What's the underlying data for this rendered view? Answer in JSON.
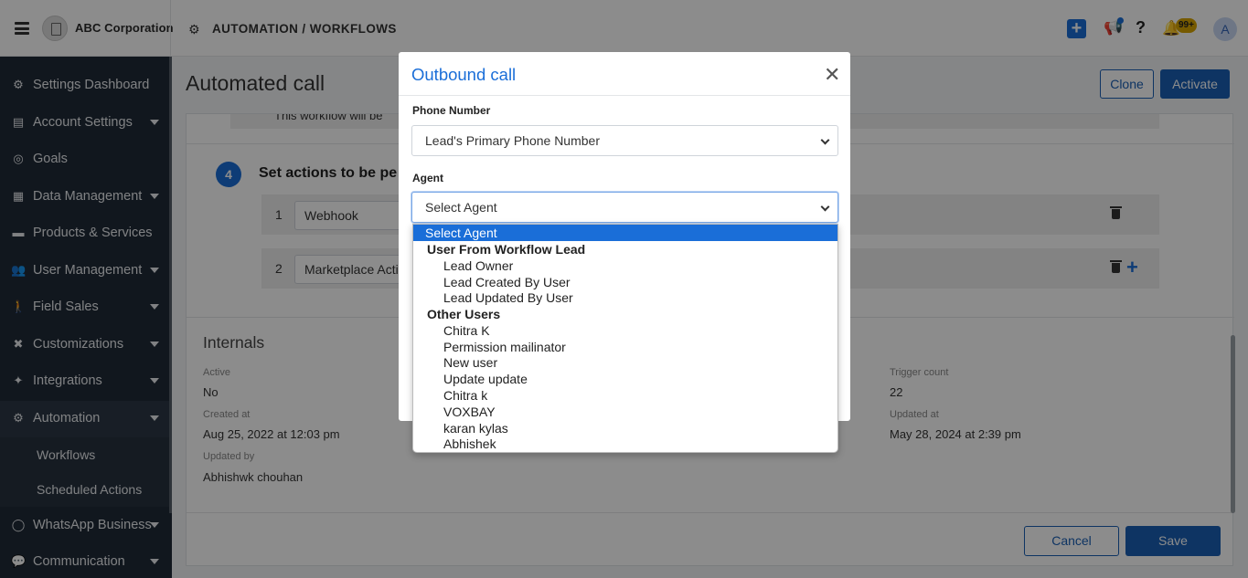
{
  "header": {
    "brand": "ABC Corporation",
    "breadcrumb": "AUTOMATION / WORKFLOWS",
    "notification_badge": "99+",
    "avatar_initial": "A"
  },
  "sidebar": {
    "items": [
      {
        "label": "Settings Dashboard",
        "icon": "gear-icon",
        "caret": false
      },
      {
        "label": "Account Settings",
        "icon": "id-card-icon",
        "caret": true
      },
      {
        "label": "Goals",
        "icon": "target-icon",
        "caret": false
      },
      {
        "label": "Data Management",
        "icon": "table-icon",
        "caret": true
      },
      {
        "label": "Products & Services",
        "icon": "box-icon",
        "caret": false
      },
      {
        "label": "User Management",
        "icon": "users-icon",
        "caret": true
      },
      {
        "label": "Field Sales",
        "icon": "person-walk-icon",
        "caret": true
      },
      {
        "label": "Customizations",
        "icon": "tools-icon",
        "caret": true
      },
      {
        "label": "Integrations",
        "icon": "magic-wand-icon",
        "caret": true
      },
      {
        "label": "Automation",
        "icon": "cogs-icon",
        "caret": true
      }
    ],
    "sub_items": [
      "Workflows",
      "Scheduled Actions"
    ],
    "items_after": [
      {
        "label": "WhatsApp Business",
        "icon": "whatsapp-icon",
        "caret": true
      },
      {
        "label": "Communication",
        "icon": "chat-icon",
        "caret": true
      }
    ]
  },
  "main": {
    "title": "Automated call",
    "clone_label": "Clone",
    "activate_label": "Activate",
    "description_fragment": "This workflow will be",
    "step_number": "4",
    "step_title": "Set actions to be pe",
    "actions": [
      {
        "num": "1",
        "value": "Webhook"
      },
      {
        "num": "2",
        "value": "Marketplace Acti"
      }
    ],
    "internals_title": "Internals",
    "active_label": "Active",
    "active_value": "No",
    "created_label": "Created at",
    "created_value": "Aug 25, 2022 at 12:03 pm",
    "updated_by_label": "Updated by",
    "updated_by_value": "Abhishwk chouhan",
    "trigger_label": "Trigger count",
    "trigger_value": "22",
    "updated_at_label": "Updated at",
    "updated_at_value": "May 28, 2024 at 2:39 pm",
    "cancel_label": "Cancel",
    "save_label": "Save"
  },
  "modal": {
    "title": "Outbound call",
    "phone_label": "Phone Number",
    "phone_value": "Lead's Primary Phone Number",
    "agent_label": "Agent",
    "agent_value": "Select Agent",
    "options": {
      "selected": "Select Agent",
      "group1": "User From Workflow Lead",
      "group1_items": [
        "Lead Owner",
        "Lead Created By User",
        "Lead Updated By User"
      ],
      "group2": "Other Users",
      "group2_items": [
        "Chitra K",
        "Permission mailinator",
        "New user",
        "Update update",
        "Chitra k",
        "VOXBAY",
        "karan kylas",
        "Abhishek"
      ]
    }
  },
  "colors": {
    "primary": "#1a6ed8",
    "sidebar_bg": "#1f2a37"
  }
}
